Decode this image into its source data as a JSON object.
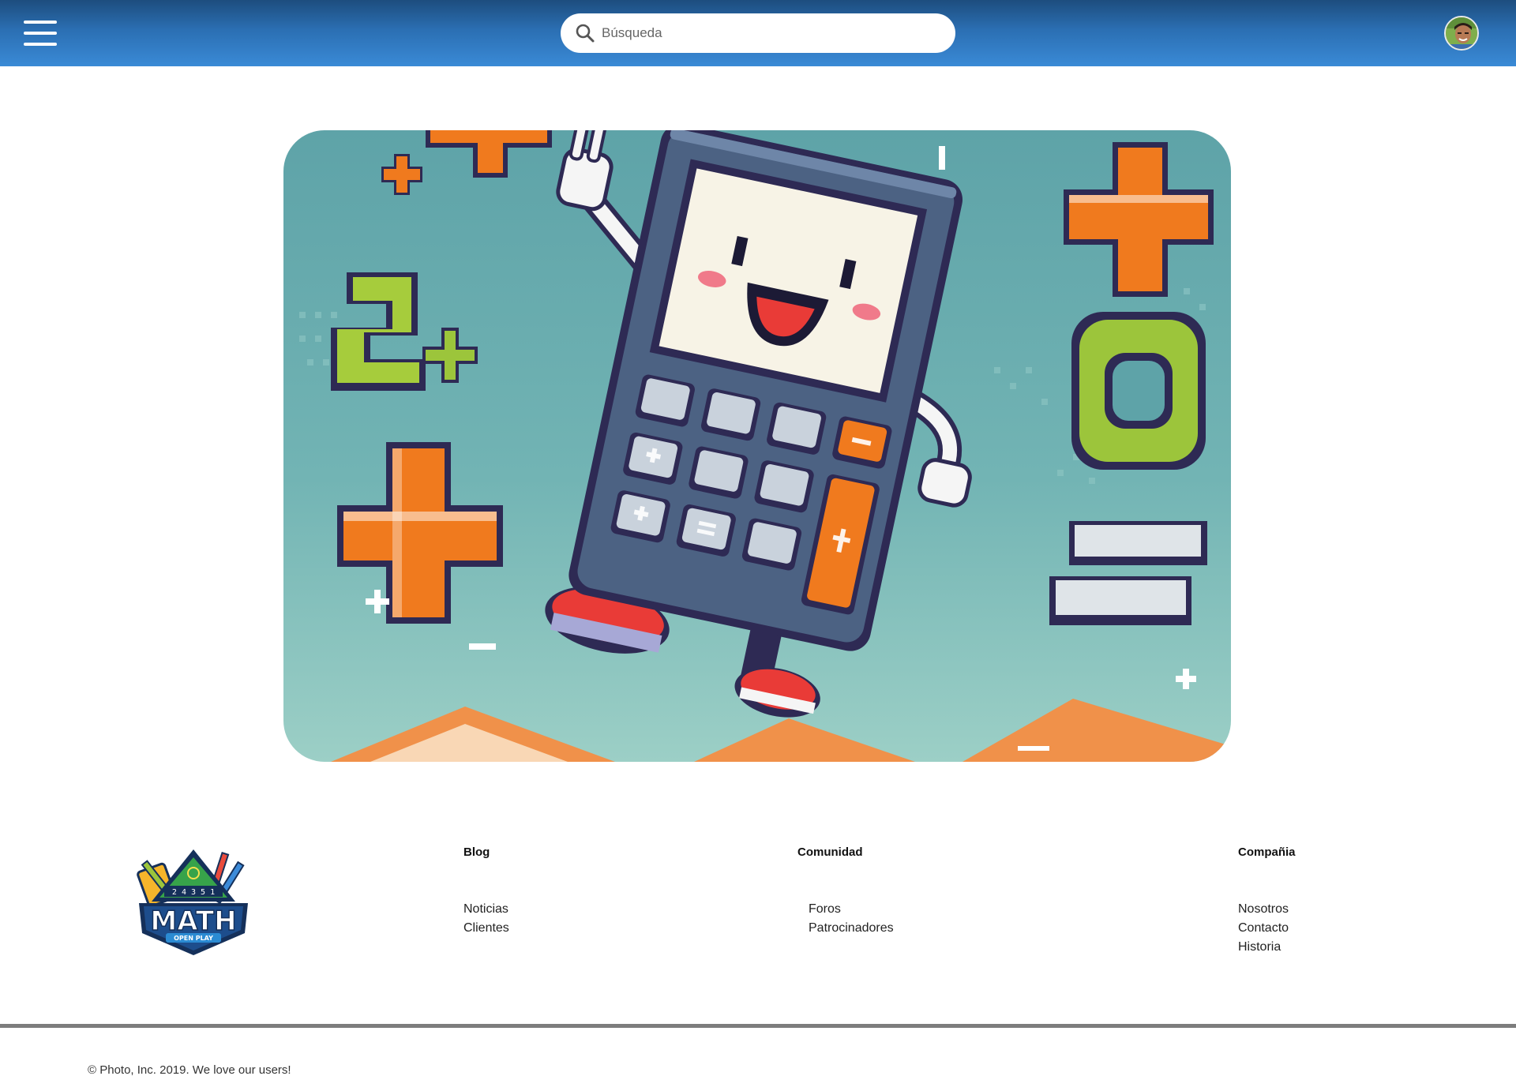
{
  "header": {
    "menu_icon": "hamburger-menu-icon",
    "search": {
      "placeholder": "Búsqueda",
      "value": "",
      "icon": "search-icon"
    },
    "avatar": "user-avatar"
  },
  "hero": {
    "image": "pixel-art-calculator-mascot",
    "alt": "Pixel art calculator character jumping among plus, minus and equals signs"
  },
  "footer": {
    "logo": {
      "title": "MATH",
      "subtitle": "OPEN PLAY",
      "digits": "2 4 3 5 1"
    },
    "columns": [
      {
        "title": "Blog",
        "links": [
          "Noticias",
          "Clientes"
        ]
      },
      {
        "title": "Comunidad",
        "links": [
          "Foros",
          "Patrocinadores"
        ]
      },
      {
        "title": "Compañia",
        "links": [
          "Nosotros",
          "Contacto",
          "Historia"
        ]
      }
    ],
    "copyright": "© Photo, Inc. 2019. We love our users!"
  },
  "colors": {
    "header_top": "#1d4d7e",
    "header_bottom": "#3a8ad6",
    "divider": "#7d7d7d",
    "accent_orange": "#f07a1e",
    "accent_green": "#9cc53b"
  }
}
